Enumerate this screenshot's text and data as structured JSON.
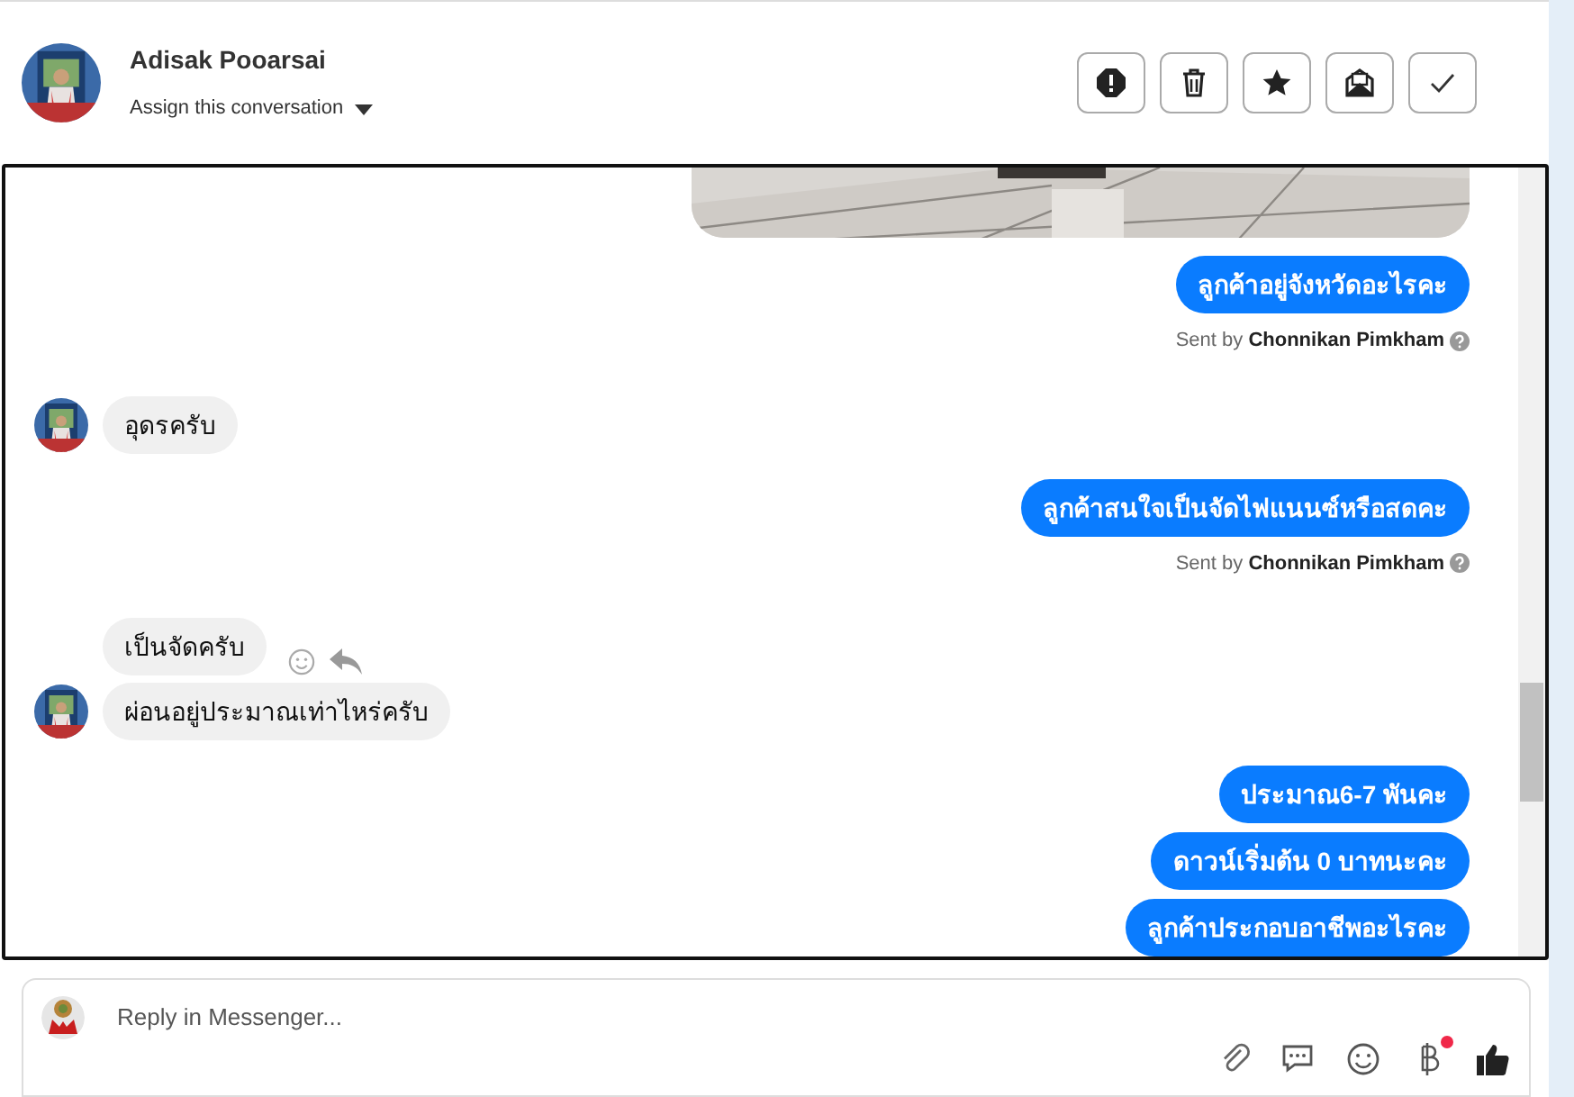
{
  "contact": {
    "name": "Adisak Pooarsai",
    "assign_label": "Assign this conversation"
  },
  "actions": [
    {
      "kind": "spam"
    },
    {
      "kind": "delete"
    },
    {
      "kind": "star"
    },
    {
      "kind": "unread"
    },
    {
      "kind": "done"
    }
  ],
  "messages": [
    {
      "kind": "picture"
    },
    {
      "kind": "out",
      "text": "ลูกค้าอยู่จังหวัดอะไรคะ"
    },
    {
      "kind": "sent_by",
      "prefix": "Sent by",
      "name": "Chonnikan Pimkham"
    },
    {
      "kind": "in",
      "text": "อุดรครับ",
      "avatar": true,
      "hover_actions": false
    },
    {
      "kind": "out",
      "text": "ลูกค้าสนใจเป็นจัดไฟแนนซ์หรือสดคะ"
    },
    {
      "kind": "sent_by",
      "prefix": "Sent by",
      "name": "Chonnikan Pimkham"
    },
    {
      "kind": "in",
      "text": "เป็นจัดครับ",
      "avatar": false,
      "hover_actions": true
    },
    {
      "kind": "in",
      "text": "ผ่อนอยู่ประมาณเท่าไหร่ครับ",
      "avatar": true,
      "hover_actions": false
    },
    {
      "kind": "out",
      "text": "ประมาณ6-7 พันคะ"
    },
    {
      "kind": "out",
      "text": "ดาวน์เริ่มต้น 0 บาทนะคะ"
    },
    {
      "kind": "out",
      "text": "ลูกค้าประกอบอาชีพอะไรคะ"
    }
  ],
  "composer": {
    "placeholder": "Reply in Messenger...",
    "tools": [
      {
        "kind": "attach"
      },
      {
        "kind": "saved_reply"
      },
      {
        "kind": "emoji"
      },
      {
        "kind": "payment",
        "notification": true
      },
      {
        "kind": "like"
      }
    ]
  }
}
